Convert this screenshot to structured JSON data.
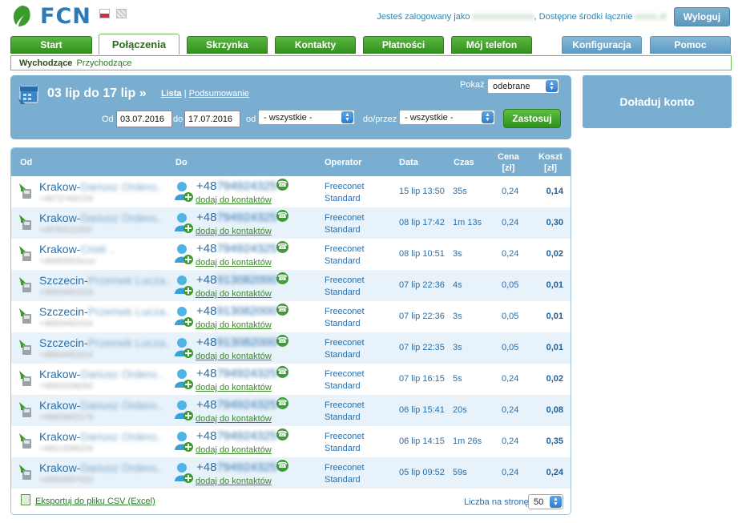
{
  "header": {
    "logo_text": "FCN",
    "logged_in_prefix": "Jesteś zalogowany jako",
    "username": "xxxxxxxxxxxxxx",
    "funds_label": ", Dostępne środki łącznie",
    "funds_value": "xxxxx zł",
    "logout_label": "Wyloguj"
  },
  "nav": {
    "tabs": [
      {
        "label": "Start"
      },
      {
        "label": "Połączenia"
      },
      {
        "label": "Skrzynka"
      },
      {
        "label": "Kontakty"
      },
      {
        "label": "Płatności"
      },
      {
        "label": "Mój telefon"
      },
      {
        "label": "Konfiguracja"
      },
      {
        "label": "Pomoc"
      }
    ],
    "subtabs": [
      {
        "label": "Wychodzące"
      },
      {
        "label": "Przychodzące"
      }
    ]
  },
  "filter": {
    "range_title": "03 lip do 17 lip »",
    "link_list": "Lista",
    "separator": "|",
    "link_summary": "Podsumowanie",
    "show_label": "Pokaż",
    "show_value": "odebrane",
    "from_label": "Od",
    "date_from": "03.07.2016",
    "to_label": "do",
    "date_to": "17.07.2016",
    "od_label": "od",
    "od_value": "- wszystkie -",
    "via_label": "do/przez",
    "via_value": "- wszystkie -",
    "apply_label": "Zastosuj"
  },
  "topup": {
    "label": "Doładuj konto"
  },
  "table": {
    "headers": {
      "from": "Od",
      "to": "Do",
      "operator": "Operator",
      "date": "Data",
      "time": "Czas",
      "price_line1": "Cena",
      "price_line2": "[zł]",
      "cost_line1": "Koszt",
      "cost_line2": "[zł]"
    },
    "add_contact_label": "dodaj do kontaktów",
    "rows": [
      {
        "from": "Krakow-",
        "from_hidden": "Dariusz Ordero..",
        "from_num": "+48737492218",
        "to_prefix": "+48",
        "to_hidden": "794924325",
        "operator_1": "Freeconet",
        "operator_2": "Standard",
        "date": "15 lip 13:50",
        "duration": "35s",
        "price": "0,24",
        "cost": "0,14"
      },
      {
        "from": "Krakow-",
        "from_hidden": "Dariusz Ordero..",
        "from_num": "+48783111500",
        "to_prefix": "+48",
        "to_hidden": "794924325",
        "operator_1": "Freeconet",
        "operator_2": "Standard",
        "date": "08 lip 17:42",
        "duration": "1m 13s",
        "price": "0,24",
        "cost": "0,30"
      },
      {
        "from": "Krakow-",
        "from_hidden": "Cristi ..",
        "from_num": "+48683353xxxx",
        "to_prefix": "+48",
        "to_hidden": "794924325",
        "operator_1": "Freeconet",
        "operator_2": "Standard",
        "date": "08 lip 10:51",
        "duration": "3s",
        "price": "0,24",
        "cost": "0,02"
      },
      {
        "from": "Szczecin-",
        "from_hidden": "Przemek Lucza..",
        "from_num": "+48604462424",
        "to_prefix": "+48",
        "to_hidden": "913082000",
        "operator_1": "Freeconet",
        "operator_2": "Standard",
        "date": "07 lip 22:36",
        "duration": "4s",
        "price": "0,05",
        "cost": "0,01"
      },
      {
        "from": "Szczecin-",
        "from_hidden": "Przemek Lucza..",
        "from_num": "+48604462424",
        "to_prefix": "+48",
        "to_hidden": "913082000",
        "operator_1": "Freeconet",
        "operator_2": "Standard",
        "date": "07 lip 22:36",
        "duration": "3s",
        "price": "0,05",
        "cost": "0,01"
      },
      {
        "from": "Szczecin-",
        "from_hidden": "Przemek Lucza..",
        "from_num": "+48604462424",
        "to_prefix": "+48",
        "to_hidden": "913082000",
        "operator_1": "Freeconet",
        "operator_2": "Standard",
        "date": "07 lip 22:35",
        "duration": "3s",
        "price": "0,05",
        "cost": "0,01"
      },
      {
        "from": "Krakow-",
        "from_hidden": "Dariusz Ordero..",
        "from_num": "+48501538282",
        "to_prefix": "+48",
        "to_hidden": "794924325",
        "operator_1": "Freeconet",
        "operator_2": "Standard",
        "date": "07 lip 16:15",
        "duration": "5s",
        "price": "0,24",
        "cost": "0,02"
      },
      {
        "from": "Krakow-",
        "from_hidden": "Dariusz Ordero..",
        "from_num": "+48600662179",
        "to_prefix": "+48",
        "to_hidden": "794924325",
        "operator_1": "Freeconet",
        "operator_2": "Standard",
        "date": "06 lip 15:41",
        "duration": "20s",
        "price": "0,24",
        "cost": "0,08"
      },
      {
        "from": "Krakow-",
        "from_hidden": "Dariusz Ordero..",
        "from_num": "+48512595218",
        "to_prefix": "+48",
        "to_hidden": "794924325",
        "operator_1": "Freeconet",
        "operator_2": "Standard",
        "date": "06 lip 14:15",
        "duration": "1m 26s",
        "price": "0,24",
        "cost": "0,35"
      },
      {
        "from": "Krakow-",
        "from_hidden": "Dariusz Ordero..",
        "from_num": "+48609657623",
        "to_prefix": "+48",
        "to_hidden": "794924325",
        "operator_1": "Freeconet",
        "operator_2": "Standard",
        "date": "05 lip 09:52",
        "duration": "59s",
        "price": "0,24",
        "cost": "0,24"
      }
    ]
  },
  "footer": {
    "csv_label": "Eksportuj do pliku CSV (Excel)",
    "per_page_label": "Liczba na stronę",
    "per_page_value": "50"
  }
}
